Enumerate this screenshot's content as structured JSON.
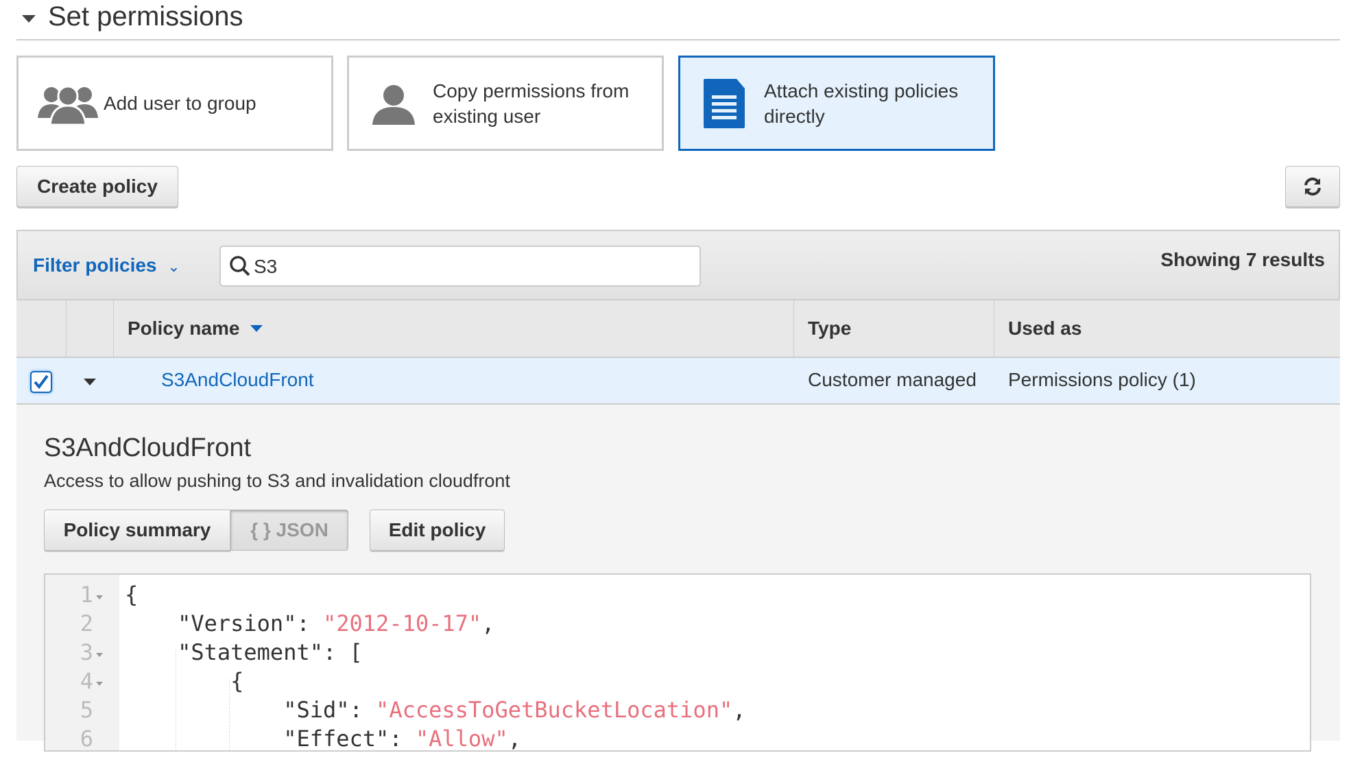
{
  "section": {
    "title": "Set permissions"
  },
  "options": [
    {
      "label": "Add user to group",
      "icon": "group-icon",
      "selected": false
    },
    {
      "label": "Copy permissions from existing user",
      "line1": "Copy permissions from",
      "line2": "existing user",
      "icon": "user-icon",
      "selected": false
    },
    {
      "label": "Attach existing policies directly",
      "line1": "Attach existing policies",
      "line2": "directly",
      "icon": "document-icon",
      "selected": true
    }
  ],
  "toolbar": {
    "create_policy": "Create policy",
    "refresh_icon": "refresh-icon"
  },
  "filter": {
    "label": "Filter policies",
    "search_value": "S3",
    "results": "Showing 7 results"
  },
  "table": {
    "columns": [
      "Policy name",
      "Type",
      "Used as"
    ],
    "rows": [
      {
        "checked": true,
        "name": "S3AndCloudFront",
        "type": "Customer managed",
        "used_as": "Permissions policy (1)"
      }
    ]
  },
  "detail": {
    "title": "S3AndCloudFront",
    "description": "Access to allow pushing to S3 and invalidation cloudfront",
    "tabs": [
      "Policy summary",
      "{ } JSON"
    ],
    "edit_button": "Edit policy",
    "code_lines": [
      {
        "n": "1",
        "k": "{",
        "v": "",
        "e": ""
      },
      {
        "n": "2",
        "k": "    \"Version\": ",
        "v": "\"2012-10-17\"",
        "e": ","
      },
      {
        "n": "3",
        "k": "    \"Statement\": [",
        "v": "",
        "e": ""
      },
      {
        "n": "4",
        "k": "        {",
        "v": "",
        "e": ""
      },
      {
        "n": "5",
        "k": "            \"Sid\": ",
        "v": "\"AccessToGetBucketLocation\"",
        "e": ","
      },
      {
        "n": "6",
        "k": "            \"Effect\": ",
        "v": "\"Allow\"",
        "e": ","
      }
    ]
  },
  "colors": {
    "accent": "#1166bb",
    "selected_bg": "#e5f2fd",
    "string": "#e8707d"
  }
}
